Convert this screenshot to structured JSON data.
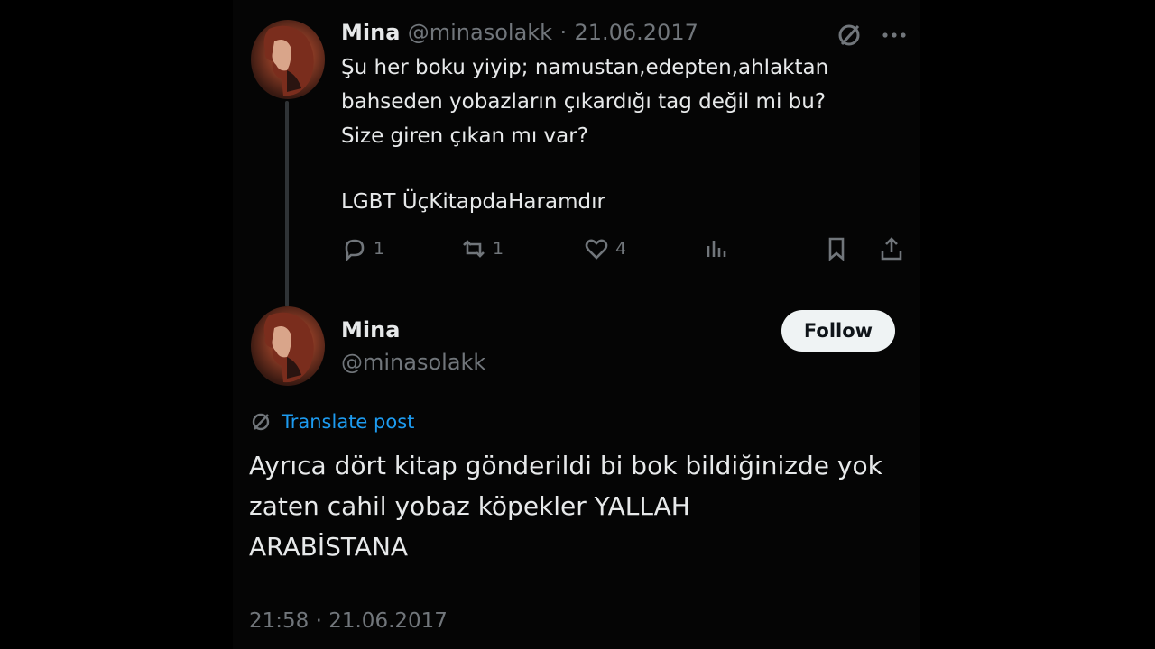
{
  "first_post": {
    "author_name": "Mina",
    "handle": "@minasolakk",
    "separator": "·",
    "date": "21.06.2017",
    "text": "Şu her boku yiyip; namustan,edepten,ahlaktan\nbahseden yobazların çıkardığı tag değil mi bu?\nSize giren çıkan mı var?",
    "tags": "LGBT ÜçKitapdaHaramdır",
    "replies": "1",
    "reposts": "1",
    "likes": "4"
  },
  "second_post": {
    "author_name": "Mina",
    "handle": "@minasolakk",
    "follow_label": "Follow",
    "translate_label": "Translate post",
    "text": "Ayrıca dört kitap gönderildi bi bok bildiğinizde yok\nzaten cahil yobaz köpekler YALLAH\nARABİSTANA",
    "time": "21:58",
    "separator": "·",
    "date": "21.06.2017"
  },
  "colors": {
    "background": "#000000",
    "text": "#e7e9ea",
    "muted": "#71767b",
    "link": "#1d9bf0",
    "follow_bg": "#eff3f4"
  },
  "icons": [
    "reply-icon",
    "repost-icon",
    "like-icon",
    "views-icon",
    "bookmark-icon",
    "share-icon",
    "grok-icon",
    "more-icon",
    "translate-icon"
  ]
}
